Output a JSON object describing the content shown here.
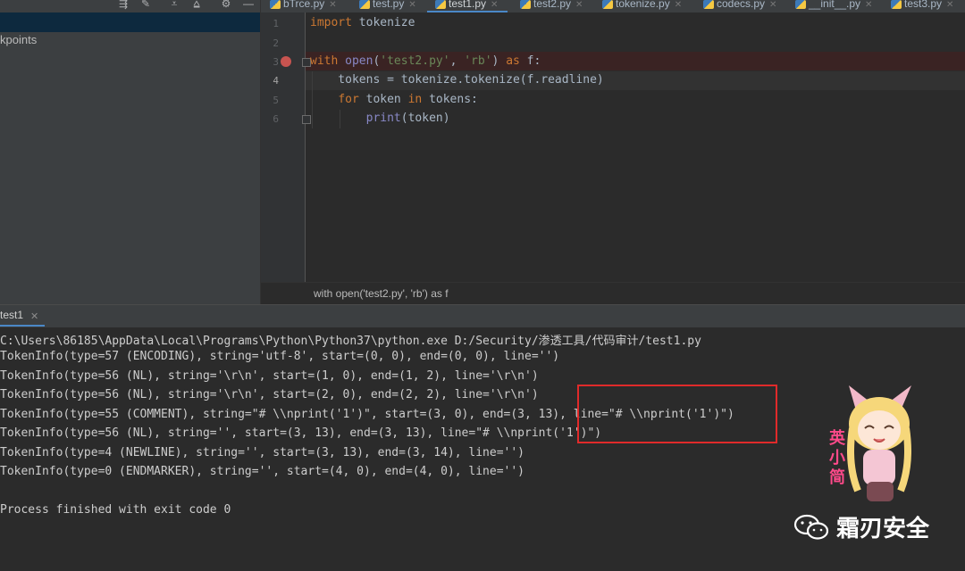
{
  "left_panel": {
    "breakpoints_label": "kpoints"
  },
  "tabs": [
    {
      "label": "bTrce.py",
      "active": false
    },
    {
      "label": "test.py",
      "active": false
    },
    {
      "label": "test1.py",
      "active": true
    },
    {
      "label": "test2.py",
      "active": false
    },
    {
      "label": "tokenize.py",
      "active": false
    },
    {
      "label": "codecs.py",
      "active": false
    },
    {
      "label": "__init__.py",
      "active": false
    },
    {
      "label": "test3.py",
      "active": false
    }
  ],
  "editor": {
    "line_numbers": [
      "1",
      "2",
      "3",
      "4",
      "5",
      "6"
    ],
    "line1": {
      "kw": "import",
      "rest": " tokenize"
    },
    "line3": {
      "kw1": "with",
      "fn": "open",
      "p1": "(",
      "s1": "'test2.py'",
      "c": ", ",
      "s2": "'rb'",
      "p2": ") ",
      "kw2": "as",
      "rest": " f:"
    },
    "line4": "    tokens = tokenize.tokenize(f.readline)",
    "line5": {
      "kw1": "for",
      "mid": " token ",
      "kw2": "in",
      "rest": " tokens:"
    },
    "line6": {
      "indent": "        ",
      "bi": "print",
      "rest": "(token)"
    },
    "breadcrumb": "with open('test2.py', 'rb') as f"
  },
  "run": {
    "tab_label": "test1",
    "console_lines": [
      "C:\\Users\\86185\\AppData\\Local\\Programs\\Python\\Python37\\python.exe D:/Security/渗透工具/代码审计/test1.py",
      "TokenInfo(type=57 (ENCODING), string='utf-8', start=(0, 0), end=(0, 0), line='')",
      "TokenInfo(type=56 (NL), string='\\r\\n', start=(1, 0), end=(1, 2), line='\\r\\n')",
      "TokenInfo(type=56 (NL), string='\\r\\n', start=(2, 0), end=(2, 2), line='\\r\\n')",
      "TokenInfo(type=55 (COMMENT), string=\"# \\\\nprint('1')\", start=(3, 0), end=(3, 13), line=\"# \\\\nprint('1')\")",
      "TokenInfo(type=56 (NL), string='', start=(3, 13), end=(3, 13), line=\"# \\\\nprint('1')\")",
      "TokenInfo(type=4 (NEWLINE), string='', start=(3, 13), end=(3, 14), line='')",
      "TokenInfo(type=0 (ENDMARKER), string='', start=(4, 0), end=(4, 0), line='')",
      "",
      "Process finished with exit code 0"
    ]
  },
  "watermark": {
    "text": "霜刃安全",
    "mascot_caption": "英小简"
  },
  "colors": {
    "highlight_box": "#e02a2a",
    "breakpoint": "#c75450",
    "accent": "#4a88c7"
  }
}
